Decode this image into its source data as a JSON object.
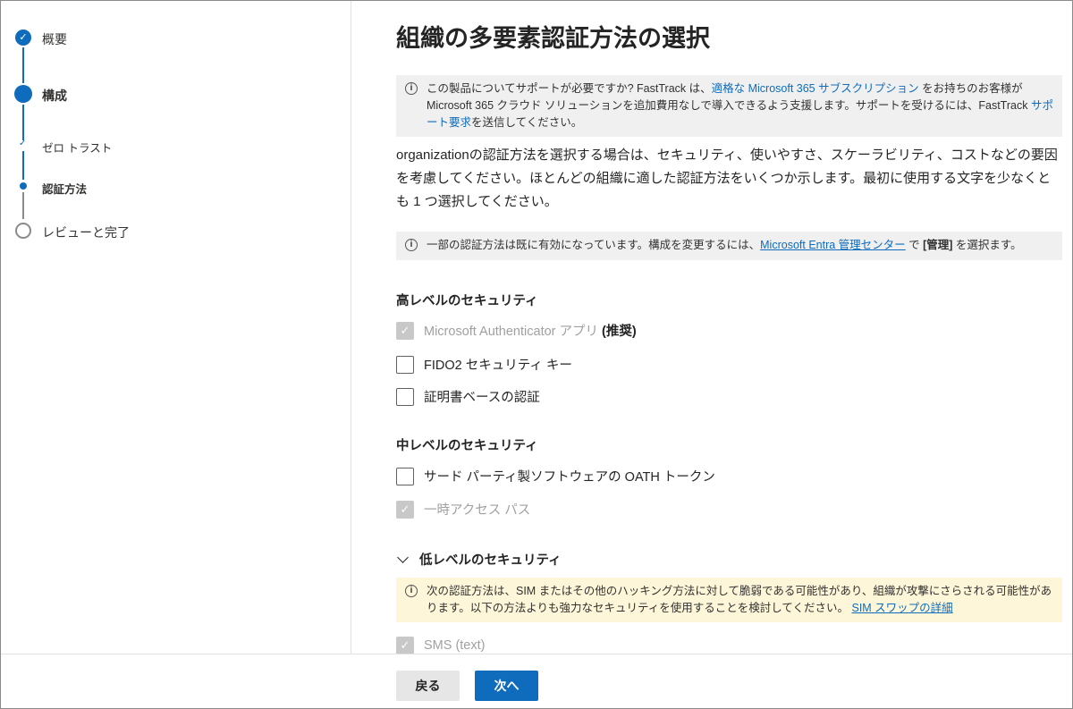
{
  "steps": [
    {
      "label": "概要",
      "state": "complete"
    },
    {
      "label": "構成",
      "state": "current"
    },
    {
      "label": "ゼロ トラスト",
      "state": "sub-complete"
    },
    {
      "label": "認証方法",
      "state": "sub-current"
    },
    {
      "label": "レビューと完了",
      "state": "pending"
    }
  ],
  "title": "組織の多要素認証方法の選択",
  "info1": {
    "t1": "この製品についてサポートが必要ですか? FastTrack は、",
    "link1": "適格な Microsoft 365 サブスクリプション",
    "t2": " をお持ちのお客様が Microsoft 365 クラウド ソリューションを追加費用なしで導入できるよう支援します。サポートを受けるには、FastTrack ",
    "link2": "サポート要求",
    "t3": "を送信してください。"
  },
  "description": "organizationの認証方法を選択する場合は、セキュリティ、使いやすさ、スケーラビリティ、コストなどの要因を考慮してください。ほとんどの組織に適した認証方法をいくつか示します。最初に使用する文字を少なくとも 1 つ選択してください。",
  "info2": {
    "t1": "一部の認証方法は既に有効になっています。構成を変更するには、",
    "link": "Microsoft Entra 管理センター",
    "t2": " で ",
    "bold": "[管理]",
    "t3": " を選択ます。"
  },
  "high": {
    "heading": "高レベルのセキュリティ",
    "items": [
      {
        "label": "Microsoft Authenticator アプリ",
        "suffix": "(推奨)",
        "checked": true,
        "disabled": true
      },
      {
        "label": "FIDO2 セキュリティ キー",
        "checked": false,
        "disabled": false
      },
      {
        "label": "証明書ベースの認証",
        "checked": false,
        "disabled": false
      }
    ]
  },
  "medium": {
    "heading": "中レベルのセキュリティ",
    "items": [
      {
        "label": "サード パーティ製ソフトウェアの OATH トークン",
        "checked": false,
        "disabled": false
      },
      {
        "label": "一時アクセス パス",
        "checked": true,
        "disabled": true
      }
    ]
  },
  "low": {
    "heading": "低レベルのセキュリティ",
    "warning": "次の認証方法は、SIM またはその他のハッキング方法に対して脆弱である可能性があり、組織が攻撃にさらされる可能性があります。以下の方法よりも強力なセキュリティを使用することを検討してください。 ",
    "warning_link": "SIM スワップの詳細",
    "items": [
      {
        "label": "SMS (text)",
        "checked": true,
        "disabled": true
      }
    ]
  },
  "footer": {
    "back": "戻る",
    "next": "次へ"
  },
  "colors": {
    "accent": "#0f6cbd",
    "warning_bg": "#fdf6d8"
  }
}
